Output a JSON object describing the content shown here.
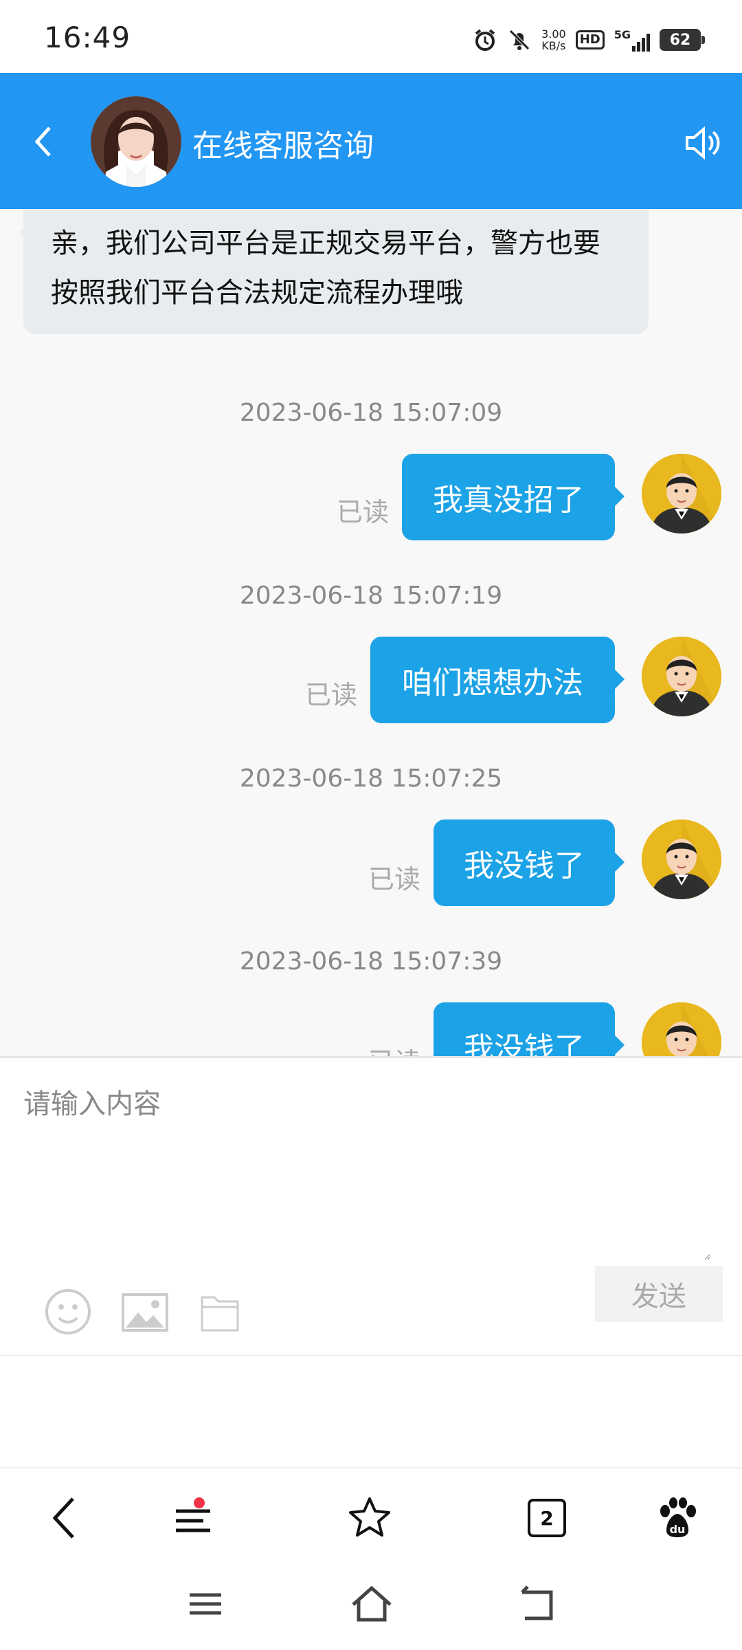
{
  "status_bar": {
    "time": "16:49",
    "net_speed_value": "3.00",
    "net_speed_unit": "KB/s",
    "hd_label": "HD",
    "network": "5G",
    "battery": "62"
  },
  "header": {
    "title": "在线客服咨询",
    "icons": [
      "back-arrow-icon",
      "speaker-icon"
    ]
  },
  "chat": {
    "incoming": {
      "text": "亲，我们公司平台是正规交易平台，警方也要按照我们平台合法规定流程办理哦"
    },
    "messages": [
      {
        "timestamp": "2023-06-18 15:07:09",
        "text": "我真没招了",
        "status": "已读"
      },
      {
        "timestamp": "2023-06-18 15:07:19",
        "text": "咱们想想办法",
        "status": "已读"
      },
      {
        "timestamp": "2023-06-18 15:07:25",
        "text": "我没钱了",
        "status": "已读"
      },
      {
        "timestamp": "2023-06-18 15:07:39",
        "text": "我没钱了",
        "status": "已读"
      }
    ]
  },
  "composer": {
    "placeholder": "请输入内容",
    "send_label": "发送",
    "tools": [
      "emoji-icon",
      "image-icon",
      "folder-icon"
    ]
  },
  "browser_toolbar": {
    "tab_count": "2",
    "items": [
      "back-icon",
      "menu-icon",
      "star-icon",
      "tabs-icon",
      "baidu-paw-icon"
    ]
  },
  "colors": {
    "header": "#2196f3",
    "outgoing_bubble": "#1ca2e6",
    "incoming_bubble": "#e8ecee"
  }
}
